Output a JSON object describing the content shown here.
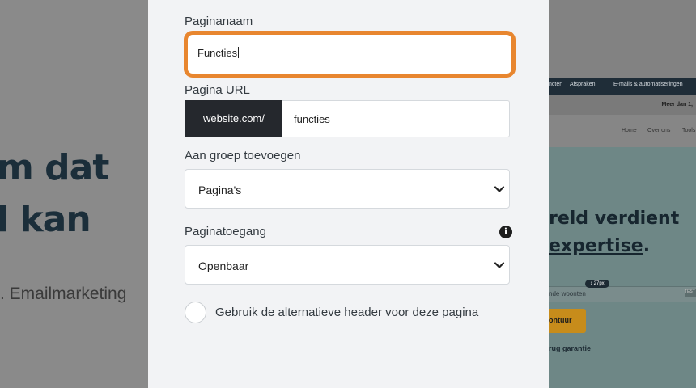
{
  "background": {
    "left_headline": "m dat\nl kan",
    "left_subtext": ". Emailmarketing",
    "right": {
      "nav_items": [
        "ncten",
        "Afspraken",
        "E-mails & automatiseringen"
      ],
      "promo_text": "Meer dan 1,",
      "menu_items": [
        "Home",
        "Over ons",
        "Tools"
      ],
      "hero_line1": "reld verdient",
      "hero_line2": "expertise",
      "hero_period": ".",
      "pill": "↕ 27px",
      "input_text": "nde woonten",
      "input_tag": "TEST",
      "button_text": "ontuur",
      "guarantee_text": "rug garantie"
    }
  },
  "modal": {
    "page_name_label": "Paginanaam",
    "page_name_value": "Functies",
    "page_url_label": "Pagina URL",
    "url_prefix": "website.com/",
    "url_value": "functies",
    "group_label": "Aan groep toevoegen",
    "group_value": "Pagina's",
    "access_label": "Paginatoegang",
    "access_value": "Openbaar",
    "info_glyph": "i",
    "alt_header_label": "Gebruik de alternatieve header voor deze pagina"
  },
  "colors": {
    "focus_outline": "#e8862f",
    "url_prefix_bg": "#25282d",
    "modal_bg": "#f2f3f5"
  }
}
